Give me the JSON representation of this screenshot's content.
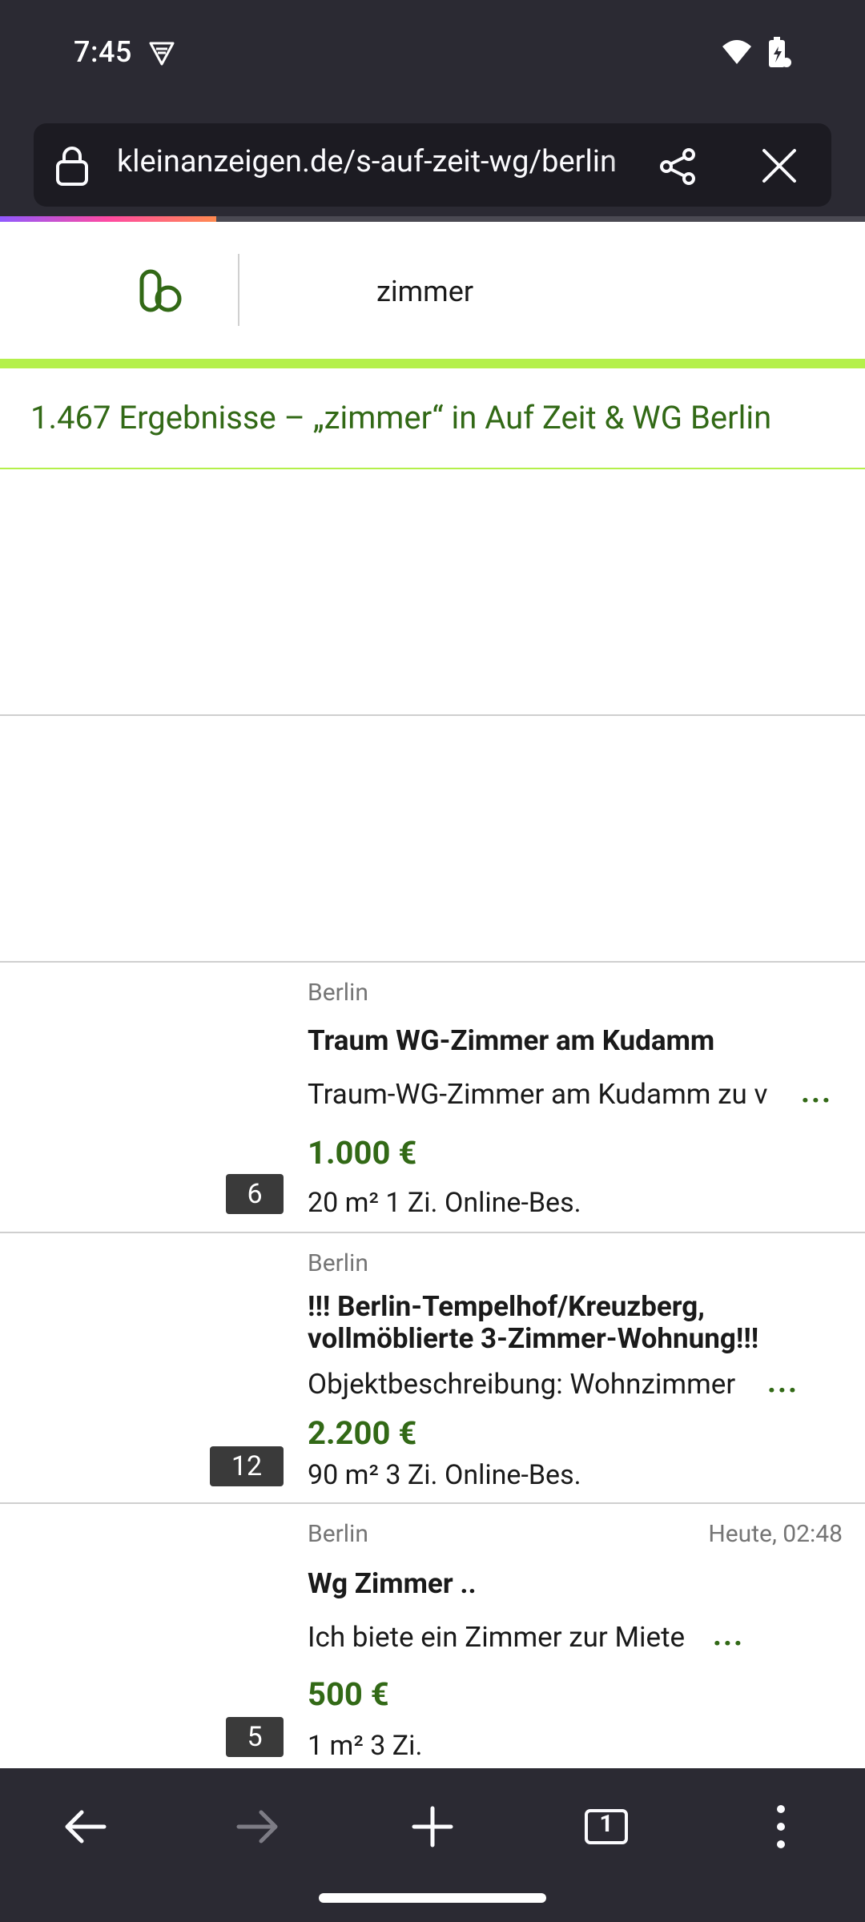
{
  "status_bar": {
    "time": "7:45",
    "icons": [
      "vpn-icon",
      "wifi-icon",
      "battery-icon"
    ]
  },
  "browser": {
    "url": "kleinanzeigen.de/s-auf-zeit-wg/berlin",
    "icons": [
      "lock-icon",
      "share-icon",
      "close-icon"
    ],
    "page_load_progress": 0.25
  },
  "site": {
    "search_query": "zimmer",
    "results_heading": "1.467 Ergebnisse – „zimmer“ in Auf Zeit & WG Berlin"
  },
  "listings": [
    {
      "location": "Berlin",
      "date": "",
      "title": "Traum WG-Zimmer am Kudamm",
      "description": "Traum-WG-Zimmer am Kudamm zu v",
      "more": "...",
      "price": "1.000 €",
      "tags": "20 m² 1 Zi. Online-Bes.",
      "image_count": "6"
    },
    {
      "location": "Berlin",
      "date": "",
      "title": "!!! Berlin-Tempelhof/Kreuzberg, vollmöblierte 3-Zimmer-Wohnung!!!",
      "description": "Objektbeschreibung: Wohnzimmer",
      "more": "...",
      "price": "2.200 €",
      "tags": "90 m² 3 Zi. Online-Bes.",
      "image_count": "12"
    },
    {
      "location": "Berlin",
      "date": "Heute, 02:48",
      "title": "Wg Zimmer ..",
      "description": "Ich biete ein Zimmer zur Miete",
      "more": "...",
      "price": "500 €",
      "tags": "1 m² 3 Zi.",
      "image_count": "5"
    }
  ],
  "bottom_nav": {
    "tab_count": "1",
    "icons": [
      "back-icon",
      "forward-icon",
      "new-tab-icon",
      "tabs-icon",
      "menu-icon"
    ]
  },
  "colors": {
    "brand_green": "#326916",
    "accent_lime": "#b4f04b",
    "browser_chrome": "#2b2a33"
  }
}
